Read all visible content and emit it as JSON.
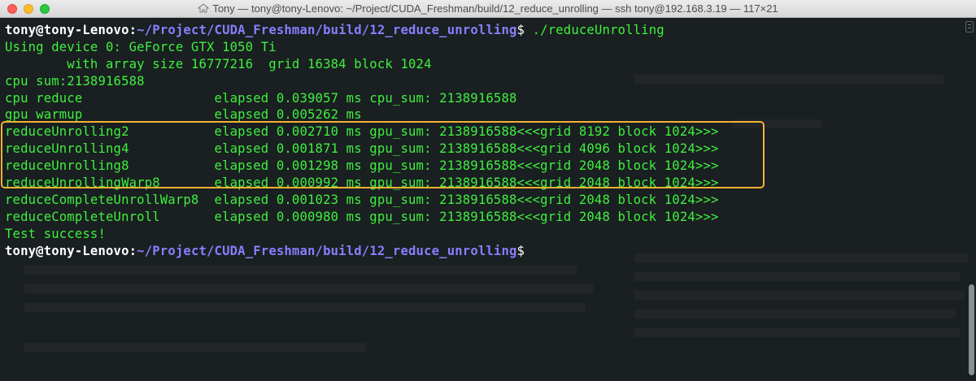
{
  "window": {
    "title": "Tony — tony@tony-Lenovo: ~/Project/CUDA_Freshman/build/12_reduce_unrolling — ssh tony@192.168.3.19 — 117×21"
  },
  "terminal": {
    "prompt_user": "tony@tony-Lenovo",
    "prompt_sep": ":",
    "prompt_path": "~/Project/CUDA_Freshman/build/12_reduce_unrolling",
    "prompt_dollar": "$",
    "command": " ./reduceUnrolling",
    "output": [
      "Using device 0: GeForce GTX 1050 Ti",
      "        with array size 16777216  grid 16384 block 1024",
      "cpu sum:2138916588",
      "cpu reduce                 elapsed 0.039057 ms cpu_sum: 2138916588",
      "gpu warmup                 elapsed 0.005262 ms",
      "reduceUnrolling2           elapsed 0.002710 ms gpu_sum: 2138916588<<<grid 8192 block 1024>>>",
      "reduceUnrolling4           elapsed 0.001871 ms gpu_sum: 2138916588<<<grid 4096 block 1024>>>",
      "reduceUnrolling8           elapsed 0.001298 ms gpu_sum: 2138916588<<<grid 2048 block 1024>>>",
      "reduceUnrollingWarp8       elapsed 0.000992 ms gpu_sum: 2138916588<<<grid 2048 block 1024>>>",
      "reduceCompleteUnrollWarp8  elapsed 0.001023 ms gpu_sum: 2138916588<<<grid 2048 block 1024>>>",
      "reduceCompleteUnroll       elapsed 0.000980 ms gpu_sum: 2138916588<<<grid 2048 block 1024>>>",
      "Test success!"
    ]
  },
  "colors": {
    "background": "#1a1f21",
    "output_text": "#3ef03e",
    "prompt_user": "#ffffff",
    "prompt_path": "#8a7dff",
    "highlight": "#f2b233"
  },
  "icons": {
    "title_icon": "home-folder-icon"
  }
}
